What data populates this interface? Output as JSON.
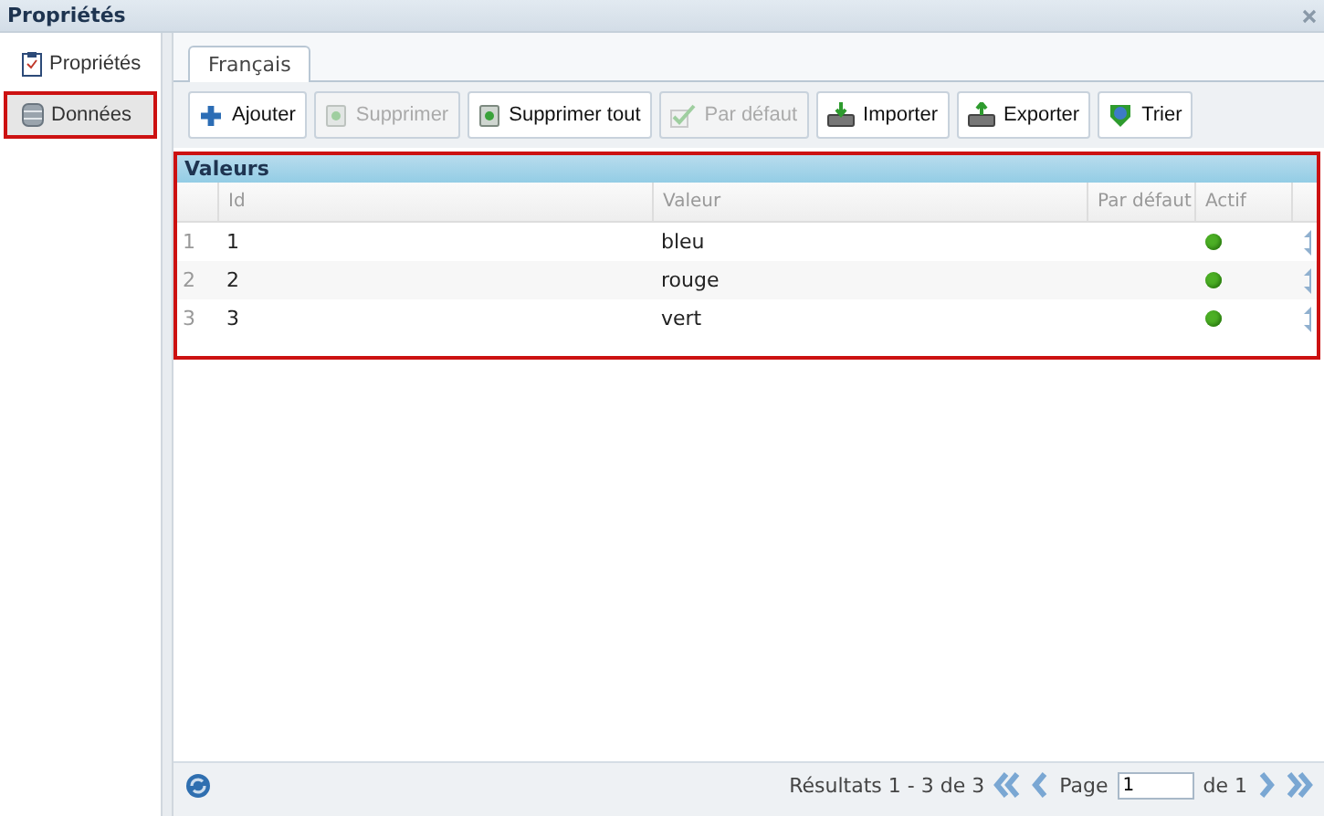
{
  "window": {
    "title": "Propriétés"
  },
  "sidebar": {
    "items": [
      {
        "label": "Propriétés",
        "kind": "clipboard",
        "selected": false,
        "highlighted": false
      },
      {
        "label": "Données",
        "kind": "database",
        "selected": true,
        "highlighted": true
      }
    ]
  },
  "tabs": [
    {
      "label": "Français",
      "selected": true
    }
  ],
  "toolbar": [
    {
      "label": "Ajouter",
      "kind": "add",
      "disabled": false
    },
    {
      "label": "Supprimer",
      "kind": "delete",
      "disabled": true
    },
    {
      "label": "Supprimer tout",
      "kind": "delete",
      "disabled": false
    },
    {
      "label": "Par défaut",
      "kind": "default",
      "disabled": true
    },
    {
      "label": "Importer",
      "kind": "import",
      "disabled": false
    },
    {
      "label": "Exporter",
      "kind": "export",
      "disabled": false
    },
    {
      "label": "Trier",
      "kind": "sort",
      "disabled": false
    }
  ],
  "grid": {
    "title": "Valeurs",
    "highlighted": true,
    "columns": [
      "Id",
      "Valeur",
      "Par défaut",
      "Actif"
    ],
    "rows": [
      {
        "number": "1",
        "id": "1",
        "value": "bleu",
        "active": true
      },
      {
        "number": "2",
        "id": "2",
        "value": "rouge",
        "active": true
      },
      {
        "number": "3",
        "id": "3",
        "value": "vert",
        "active": true
      }
    ]
  },
  "pager": {
    "summary": "Résultats 1 - 3 de 3",
    "page_label": "Page",
    "page": "1",
    "of": "de 1"
  }
}
